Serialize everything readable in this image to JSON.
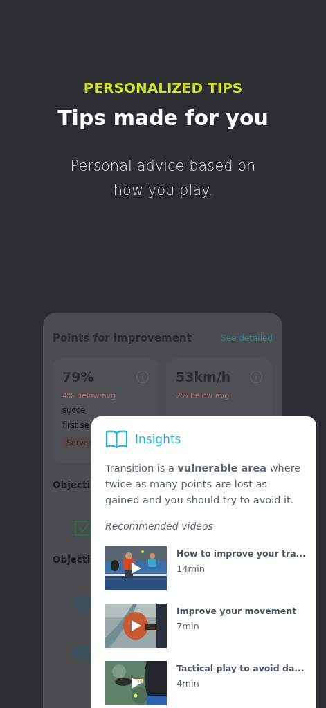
{
  "header": {
    "eyebrow": "PERSONALIZED TIPS",
    "title": "Tips made for you",
    "subtitle": "Personal advice based on how you play."
  },
  "background_card": {
    "title": "Points for improvement",
    "link": "See detailed",
    "stats": [
      {
        "value": "79%",
        "delta": "4% below avg",
        "description_lines": [
          "succe",
          "first se"
        ],
        "tag": "Serves"
      },
      {
        "value": "53km/h",
        "delta": "2% below avg"
      }
    ],
    "sections": [
      {
        "title": "Objecti",
        "items": [
          {
            "kind": "check"
          }
        ]
      },
      {
        "title": "Objecti",
        "items": [
          {
            "kind": "target"
          },
          {
            "kind": "target"
          }
        ]
      }
    ]
  },
  "insights": {
    "title": "Insights",
    "text": "Transition is a **vulnerable area** where twice as many points are lost as gained and you should try to avoid it.",
    "videos_heading": "Recommended videos",
    "videos": [
      {
        "title": "How to improve your tra...",
        "duration": "14min"
      },
      {
        "title": "Improve your movement",
        "duration": "7min"
      },
      {
        "title": "Tactical play to avoid da...",
        "duration": "4min"
      }
    ]
  }
}
